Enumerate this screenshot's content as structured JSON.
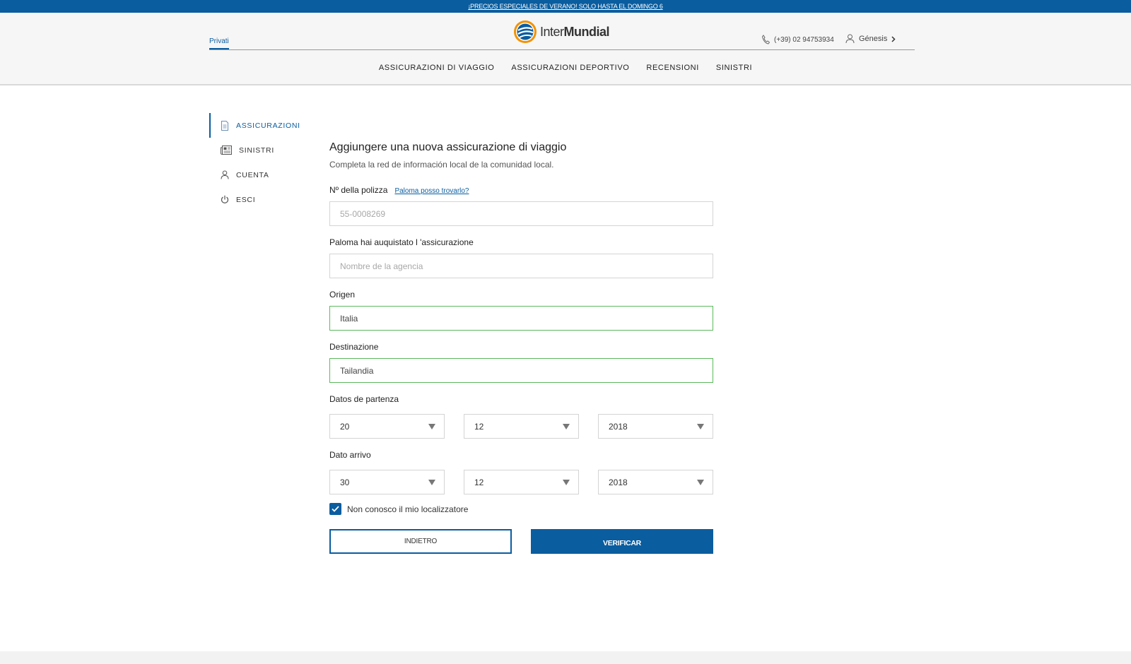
{
  "promo": {
    "text": "¡PRECIOS ESPECIALES DE VERANO! SOLO HASTA EL DOMINGO 6"
  },
  "header": {
    "segment": "Privati",
    "logo_light": "Inter",
    "logo_bold": "Mundial",
    "phone": "(+39) 02 94753934",
    "user_name": "Génesis",
    "nav": [
      "ASSICURAZIONI DI VIAGGIO",
      "ASSICURAZIONI DEPORTIVO",
      "RECENSIONI",
      "SINISTRI"
    ]
  },
  "sidebar": {
    "items": [
      {
        "label": "ASSICURAZIONI",
        "icon": "document-icon"
      },
      {
        "label": "SINISTRI",
        "icon": "newspaper-icon"
      },
      {
        "label": "CUENTA",
        "icon": "user-icon"
      },
      {
        "label": "ESCI",
        "icon": "power-icon"
      }
    ]
  },
  "form": {
    "title": "Aggiungere una nuova assicurazione di viaggio",
    "subtitle": "Completa la red de información local de la comunidad local.",
    "policy": {
      "label": "Nº della polizza",
      "help": "Paloma posso trovarlo?",
      "placeholder": "55-0008269",
      "value": ""
    },
    "agency": {
      "label": "Paloma hai auquistato l 'assicurazione",
      "placeholder": "Nombre de la agencia",
      "value": ""
    },
    "origin": {
      "label": "Origen",
      "value": "Italia"
    },
    "destination": {
      "label": "Destinazione",
      "value": "Tailandia"
    },
    "departure": {
      "label": "Datos de partenza",
      "day": "20",
      "month": "12",
      "year": "2018"
    },
    "arrival": {
      "label": "Dato arrivo",
      "day": "30",
      "month": "12",
      "year": "2018"
    },
    "no_locator": {
      "label": "Non conosco il mio localizzatore",
      "checked": true
    },
    "back_label": "INDIETRO",
    "verify_label": "VERIFICAR"
  },
  "colors": {
    "brand": "#0a5d9f",
    "valid": "#5cb85c"
  }
}
